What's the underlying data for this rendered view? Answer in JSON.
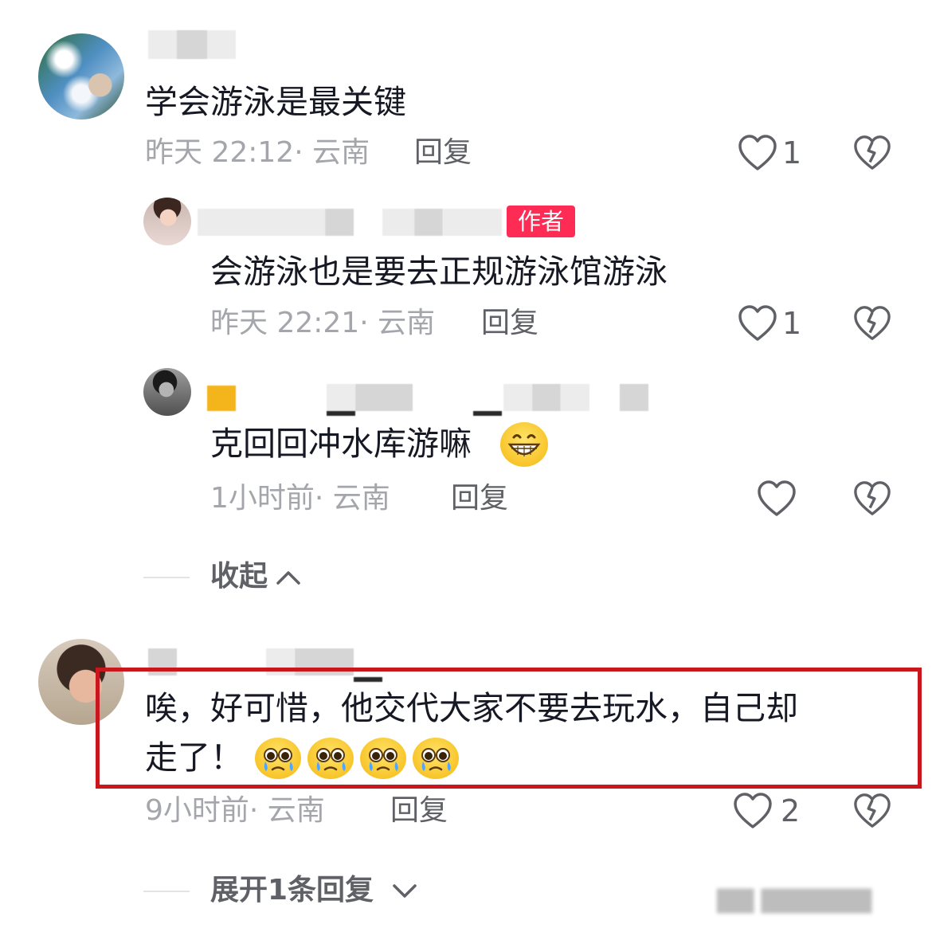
{
  "comments": [
    {
      "text": "学会游泳是最关键",
      "time": "昨天 22:12",
      "location": "· 云南",
      "reply_label": "回复",
      "like_count": "1"
    }
  ],
  "replies": [
    {
      "badge": "作者",
      "text": "会游泳也是要去正规游泳馆游泳",
      "time": "昨天 22:21",
      "location": "· 云南",
      "reply_label": "回复",
      "like_count": "1"
    },
    {
      "text": "克回回冲水库游嘛",
      "time": "1小时前",
      "location": "· 云南",
      "reply_label": "回复",
      "like_count": ""
    }
  ],
  "collapse": {
    "label": "收起"
  },
  "second_comment": {
    "line1": "唉，好可惜，他交代大家不要去玩水，自己却",
    "line2": "走了！",
    "time": "9小时前",
    "location": "· 云南",
    "reply_label": "回复",
    "like_count": "2"
  },
  "expand": {
    "label": "展开1条回复"
  },
  "icons": {
    "like": "heart-outline-icon",
    "dislike": "broken-heart-icon",
    "collapse": "chevron-up-icon",
    "expand": "chevron-down-icon",
    "emoji_grin": "grinning-emoji",
    "emoji_pleading": "pleading-face-emoji"
  },
  "colors": {
    "author_badge": "#fe2c55",
    "highlight_border": "#c8171d",
    "meta_text": "#a4a6ab",
    "primary_text": "#161823"
  }
}
